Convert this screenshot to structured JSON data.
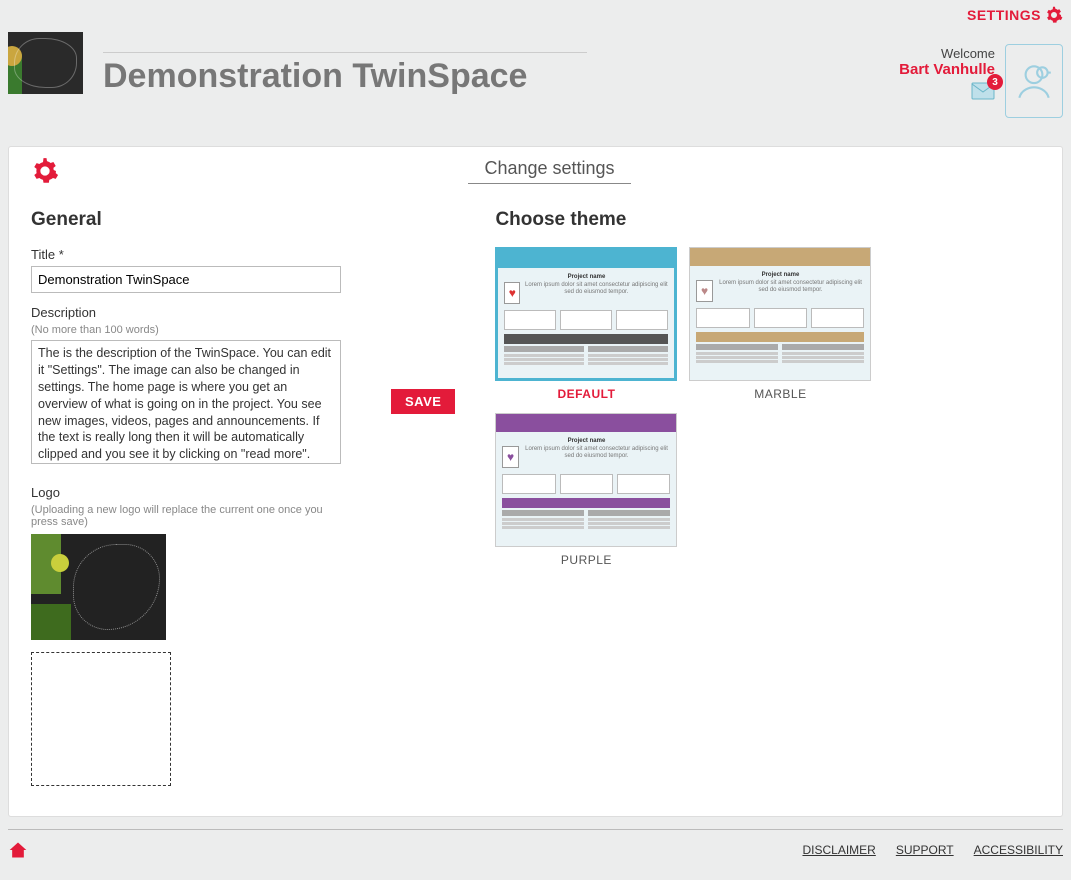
{
  "top": {
    "settings_label": "SETTINGS"
  },
  "header": {
    "title": "Demonstration TwinSpace",
    "welcome": "Welcome",
    "username": "Bart Vanhulle",
    "mail_count": "3"
  },
  "panel": {
    "title": "Change settings",
    "save_label": "SAVE"
  },
  "general": {
    "heading": "General",
    "title_label": "Title *",
    "title_value": "Demonstration TwinSpace",
    "description_label": "Description",
    "description_hint": "(No more than 100 words)",
    "description_value": "The is the description of the TwinSpace. You can edit it \"Settings\". The image can also be changed in settings. The home page is where you get an overview of what is going on in the project. You see new images, videos, pages and announcements. If the text is really long then it will be automatically clipped and you see it by clicking on \"read more\". The bulletin is a place that only teachers can see.",
    "logo_label": "Logo",
    "logo_hint": "(Uploading a new logo will replace the current one once you press save)"
  },
  "themes": {
    "heading": "Choose theme",
    "options": [
      {
        "name": "DEFAULT",
        "selected": true
      },
      {
        "name": "MARBLE",
        "selected": false
      },
      {
        "name": "PURPLE",
        "selected": false
      }
    ],
    "thumb_title": "Project name"
  },
  "footer": {
    "links": [
      "DISCLAIMER",
      "SUPPORT",
      "ACCESSIBILITY"
    ]
  }
}
